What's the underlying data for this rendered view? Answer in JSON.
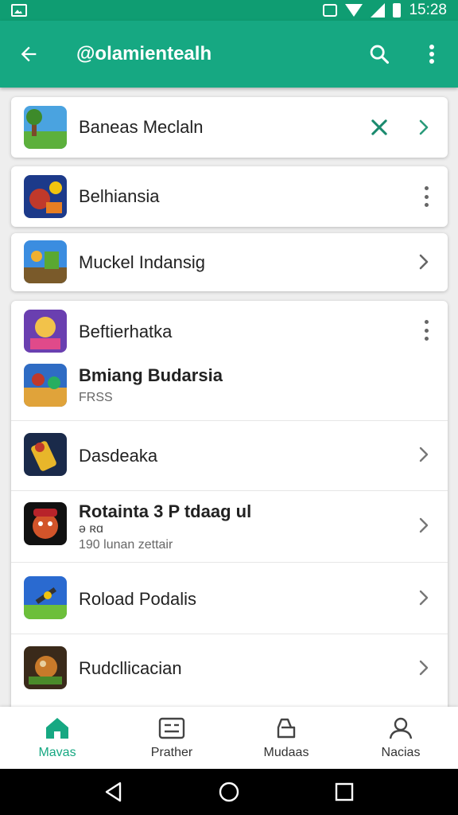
{
  "status_bar": {
    "time": "15:28"
  },
  "app_bar": {
    "title": "@olamientealh"
  },
  "cards": [
    {
      "label": "Baneas Meclaln",
      "thumb_colors": [
        "#4aa3e0",
        "#5cb03c"
      ]
    },
    {
      "label": "Belhiansia",
      "thumb_colors": [
        "#1c3a8a",
        "#c0392b"
      ]
    },
    {
      "label": "Muckel Indansig",
      "thumb_colors": [
        "#3b8de0",
        "#7a5a2a"
      ]
    }
  ],
  "list": [
    {
      "label": "Beftierhatka",
      "thumb_colors": [
        "#6a3fb0",
        "#f2c24a"
      ]
    },
    {
      "label": "Bmiang Budarsia",
      "sub": "FRSS",
      "thumb_colors": [
        "#2f6cc4",
        "#e0a33a"
      ]
    },
    {
      "label": "Dasdeaka",
      "thumb_colors": [
        "#1a2a4a",
        "#e8b62a"
      ]
    },
    {
      "label": "Rotainta 3 P tdaag ul",
      "sub1": "ə ʀɑ",
      "sub2": "190 lunan zettair",
      "thumb_colors": [
        "#111111",
        "#d2542a"
      ]
    },
    {
      "label": "Roload Podalis",
      "thumb_colors": [
        "#2a6ad0",
        "#6cbf3a"
      ]
    },
    {
      "label": "Rudcllicacian",
      "thumb_colors": [
        "#3a2a1a",
        "#c87a2a"
      ]
    }
  ],
  "bottom_nav": [
    {
      "label": "Mavas",
      "icon": "home-icon"
    },
    {
      "label": "Prather",
      "icon": "list-card-icon"
    },
    {
      "label": "Mudaas",
      "icon": "bag-icon"
    },
    {
      "label": "Nacias",
      "icon": "person-icon"
    }
  ],
  "colors": {
    "primary": "#16a882",
    "status": "#0f9d72"
  }
}
